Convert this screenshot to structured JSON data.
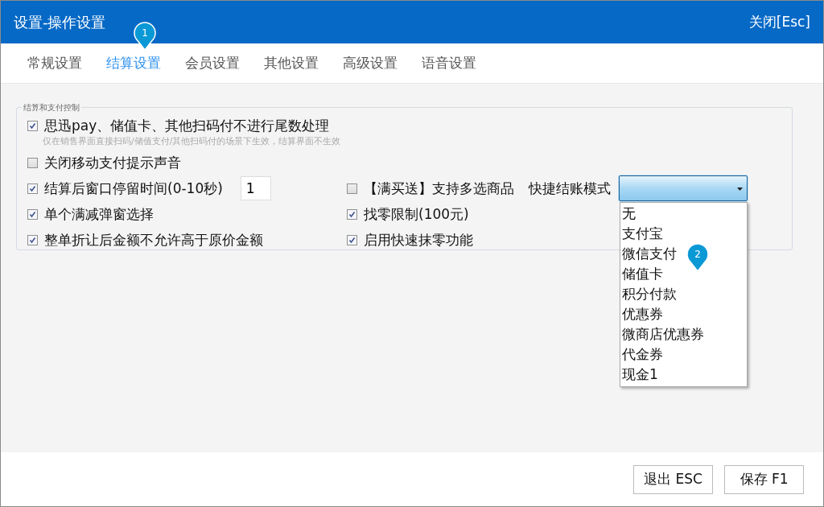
{
  "window": {
    "title": "设置-操作设置",
    "close": "关闭[Esc]"
  },
  "tabs": [
    {
      "label": "常规设置",
      "selected": false
    },
    {
      "label": "结算设置",
      "selected": true,
      "marker": "1"
    },
    {
      "label": "会员设置",
      "selected": false
    },
    {
      "label": "其他设置",
      "selected": false
    },
    {
      "label": "高级设置",
      "selected": false
    },
    {
      "label": "语音设置",
      "selected": false
    }
  ],
  "group": {
    "legend": "结算和支付控制",
    "top": [
      {
        "label": "思迅pay、储值卡、其他扫码付不进行尾数处理",
        "hint": "仅在销售界面直接扫码/储值支付/其他扫码付的场景下生效，结算界面不生效",
        "checked": true
      },
      {
        "label": "关闭移动支付提示声音",
        "checked": false
      }
    ],
    "left": [
      {
        "kind": "number",
        "label": "结算后窗口停留时间(0-10秒)",
        "checked": true,
        "value": "1"
      },
      {
        "kind": "checkbox",
        "label": "单个满减弹窗选择",
        "checked": true
      },
      {
        "kind": "checkbox",
        "label": "整单折让后金额不允许高于原价金额",
        "checked": true
      }
    ],
    "right": [
      {
        "label": "【满买送】支持多选商品",
        "checked": false
      },
      {
        "label": "找零限制(100元)",
        "checked": true
      },
      {
        "label": "启用快速抹零功能",
        "checked": true
      }
    ],
    "quick_checkout": {
      "label": "快捷结账模式",
      "expanded": true,
      "options": [
        {
          "label": "无"
        },
        {
          "label": "支付宝"
        },
        {
          "label": "微信支付"
        },
        {
          "label": "储值卡",
          "marker": "2"
        },
        {
          "label": "积分付款"
        },
        {
          "label": "优惠券"
        },
        {
          "label": "微商店优惠券"
        },
        {
          "label": "代金券"
        },
        {
          "label": "现金1"
        }
      ]
    }
  },
  "buttons": [
    "退出 ESC",
    "保存 F1"
  ]
}
